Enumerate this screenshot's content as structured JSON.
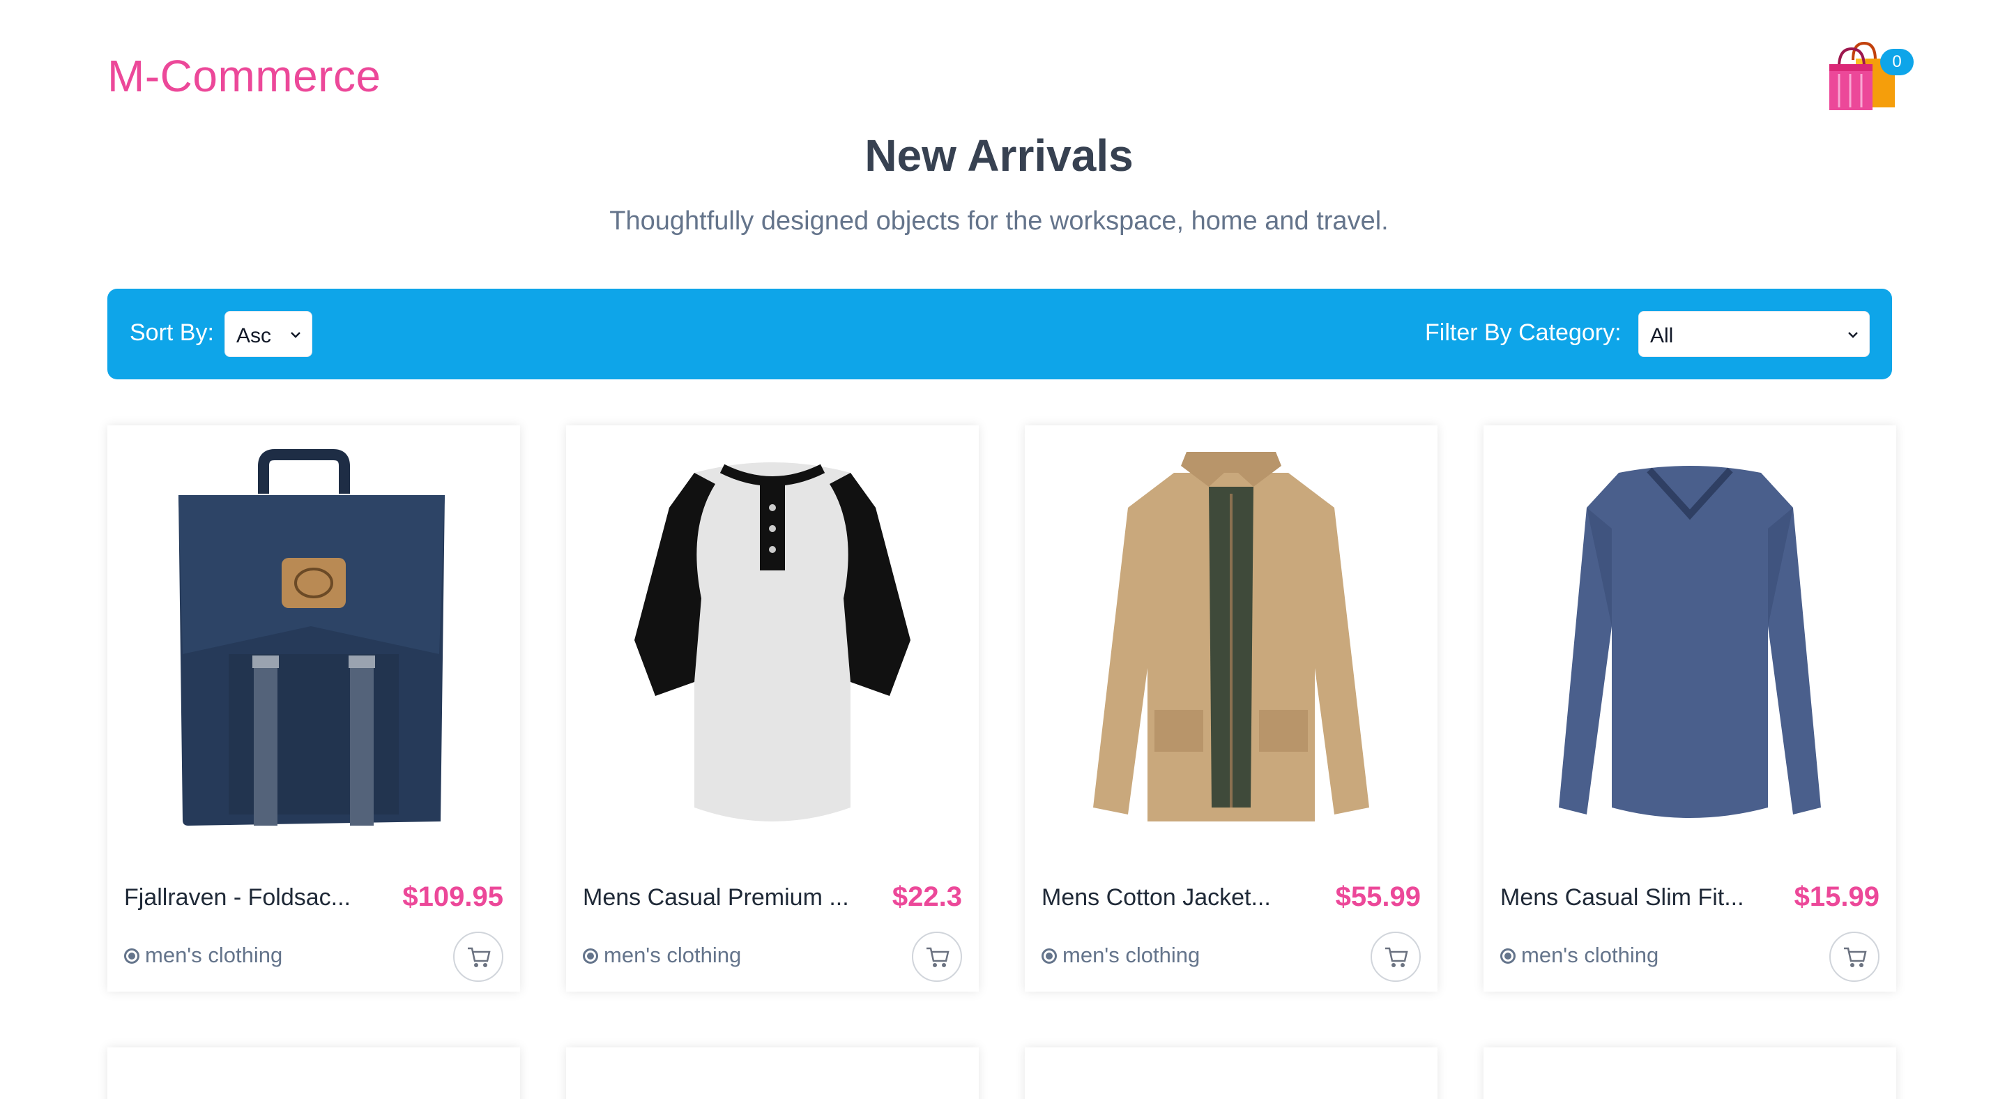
{
  "brand": "M-Commerce",
  "cart": {
    "count": "0",
    "icon": "shopping-bags-icon"
  },
  "hero": {
    "title": "New Arrivals",
    "subtitle": "Thoughtfully designed objects for the workspace, home and travel."
  },
  "toolbar": {
    "sort_label": "Sort By:",
    "sort_value": "Asc",
    "filter_label": "Filter By Category:",
    "filter_value": "All"
  },
  "products": [
    {
      "title": "Fjallraven - Foldsac...",
      "price": "$109.95",
      "category": "men's clothing",
      "image": "backpack"
    },
    {
      "title": "Mens Casual Premium ...",
      "price": "$22.3",
      "category": "men's clothing",
      "image": "raglan-tshirt"
    },
    {
      "title": "Mens Cotton Jacket...",
      "price": "$55.99",
      "category": "men's clothing",
      "image": "cotton-jacket"
    },
    {
      "title": "Mens Casual Slim Fit...",
      "price": "$15.99",
      "category": "men's clothing",
      "image": "longsleeve-tshirt"
    }
  ],
  "colors": {
    "accent": "#ec4899",
    "toolbar": "#0ea5e9"
  }
}
